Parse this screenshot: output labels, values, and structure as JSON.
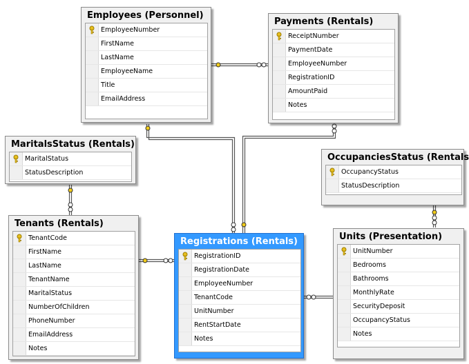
{
  "tables": {
    "employees": {
      "title": "Employees (Personnel)",
      "columns": [
        "EmployeeNumber",
        "FirstName",
        "LastName",
        "EmployeeName",
        "Title",
        "EmailAddress"
      ]
    },
    "payments": {
      "title": "Payments (Rentals)",
      "columns": [
        "ReceiptNumber",
        "PaymentDate",
        "EmployeeNumber",
        "RegistrationID",
        "AmountPaid",
        "Notes"
      ]
    },
    "marital": {
      "title": "MaritalsStatus (Rentals)",
      "columns": [
        "MaritalStatus",
        "StatusDescription"
      ]
    },
    "occupancies": {
      "title": "OccupanciesStatus (Rentals)",
      "columns": [
        "OccupancyStatus",
        "StatusDescription"
      ]
    },
    "tenants": {
      "title": "Tenants (Rentals)",
      "columns": [
        "TenantCode",
        "FirstName",
        "LastName",
        "TenantName",
        "MaritalStatus",
        "NumberOfChildren",
        "PhoneNumber",
        "EmailAddress",
        "Notes"
      ]
    },
    "registrations": {
      "title": "Registrations (Rentals)",
      "columns": [
        "RegistrationID",
        "RegistrationDate",
        "EmployeeNumber",
        "TenantCode",
        "UnitNumber",
        "RentStartDate",
        "Notes"
      ]
    },
    "units": {
      "title": "Units (Presentation)",
      "columns": [
        "UnitNumber",
        "Bedrooms",
        "Bathrooms",
        "MonthlyRate",
        "SecurityDeposit",
        "OccupancyStatus",
        "Notes"
      ]
    }
  },
  "colors": {
    "selected_title_bg": "#3399ff",
    "key_icon": "#e8c020",
    "connector": "#555555"
  }
}
